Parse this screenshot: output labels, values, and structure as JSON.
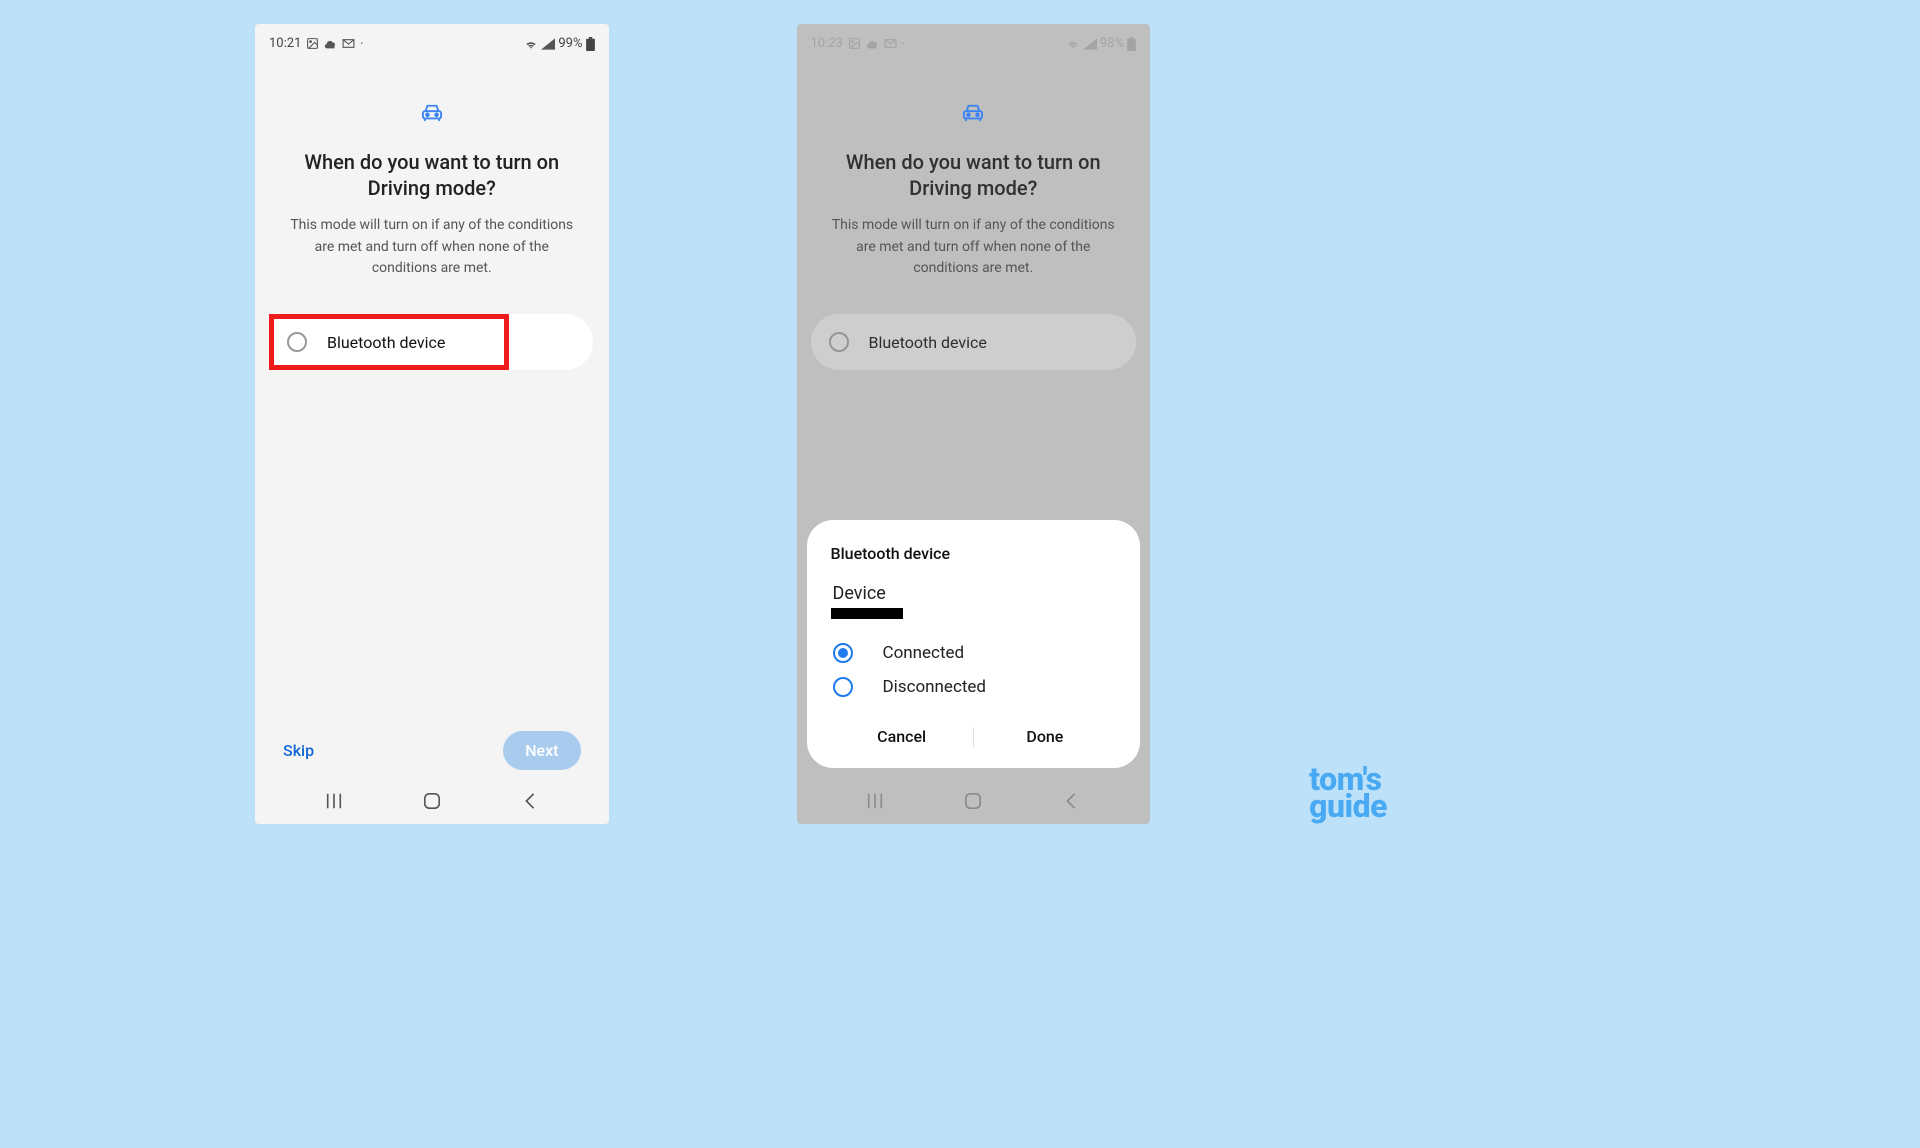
{
  "left": {
    "statusbar": {
      "time": "10:21",
      "battery": "99%"
    },
    "heading": "When do you want to turn on Driving mode?",
    "subtext": "This mode will turn on if any of the conditions are met and turn off when none of the conditions are met.",
    "option_label": "Bluetooth device",
    "skip": "Skip",
    "next": "Next"
  },
  "right": {
    "statusbar": {
      "time": "10:23",
      "battery": "98%"
    },
    "heading": "When do you want to turn on Driving mode?",
    "subtext": "This mode will turn on if any of the conditions are met and turn off when none of the conditions are met.",
    "option_label": "Bluetooth device",
    "sheet": {
      "title": "Bluetooth device",
      "device_label": "Device",
      "connected": "Connected",
      "disconnected": "Disconnected",
      "cancel": "Cancel",
      "done": "Done"
    }
  },
  "watermark": {
    "t": "tom's",
    "g": "guide"
  },
  "colors": {
    "accent": "#1e7cef",
    "highlight": "#ee1b1b"
  }
}
